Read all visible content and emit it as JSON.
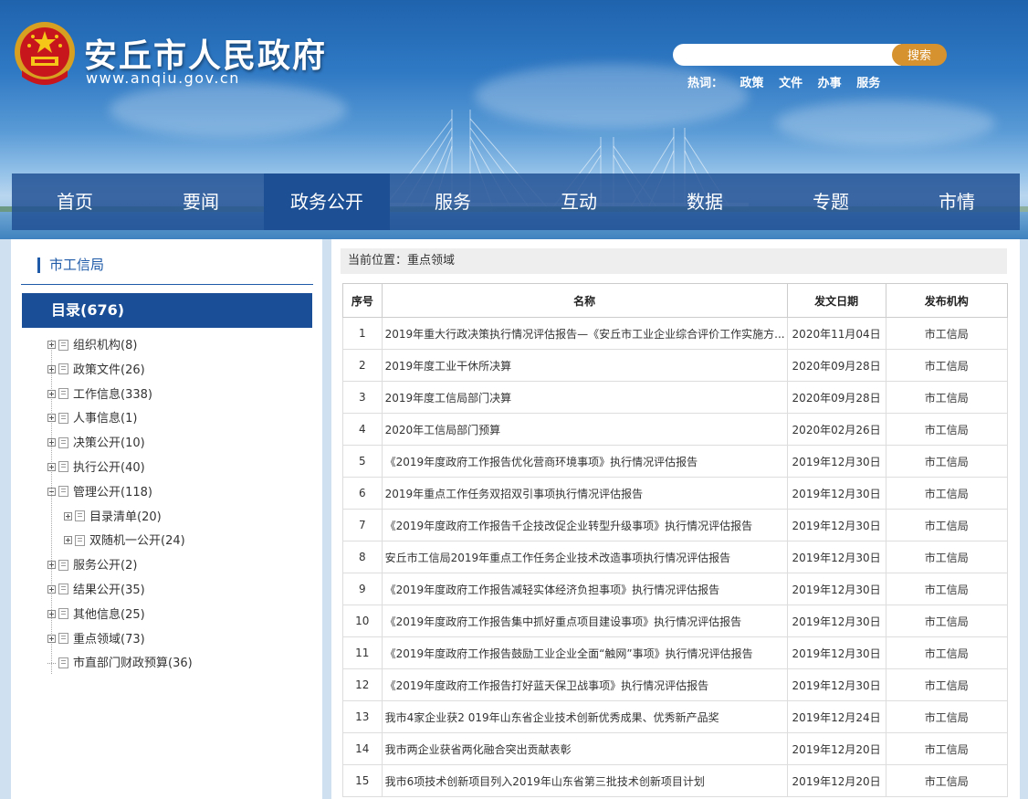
{
  "site": {
    "title": "安丘市人民政府",
    "url": "www.anqiu.gov.cn",
    "search_placeholder": "",
    "search_button": "搜索",
    "hotwords_label": "热词：",
    "hotwords": [
      "政策",
      "文件",
      "办事",
      "服务"
    ]
  },
  "nav": {
    "items": [
      "首页",
      "要闻",
      "政务公开",
      "服务",
      "互动",
      "数据",
      "专题",
      "市情"
    ],
    "active": "政务公开"
  },
  "sidebar": {
    "dept": "市工信局",
    "catalog": "目录(676)",
    "tree": [
      {
        "label": "组织机构(8)",
        "expander": "plus"
      },
      {
        "label": "政策文件(26)",
        "expander": "plus"
      },
      {
        "label": "工作信息(338)",
        "expander": "plus"
      },
      {
        "label": "人事信息(1)",
        "expander": "plus"
      },
      {
        "label": "决策公开(10)",
        "expander": "plus"
      },
      {
        "label": "执行公开(40)",
        "expander": "plus"
      },
      {
        "label": "管理公开(118)",
        "expander": "minus"
      },
      {
        "label": "目录清单(20)",
        "expander": "plus",
        "child": true
      },
      {
        "label": "双随机一公开(24)",
        "expander": "plus",
        "child": true
      },
      {
        "label": "服务公开(2)",
        "expander": "plus"
      },
      {
        "label": "结果公开(35)",
        "expander": "plus"
      },
      {
        "label": "其他信息(25)",
        "expander": "plus"
      },
      {
        "label": "重点领域(73)",
        "expander": "plus"
      },
      {
        "label": "市直部门财政预算(36)",
        "expander": "none"
      }
    ]
  },
  "main": {
    "breadcrumb": "当前位置：重点领域",
    "columns": [
      "序号",
      "名称",
      "发文日期",
      "发布机构"
    ],
    "rows": [
      {
        "idx": "1",
        "name": "2019年重大行政决策执行情况评估报告—《安丘市工业企业综合评价工作实施方...",
        "date": "2020年11月04日",
        "org": "市工信局"
      },
      {
        "idx": "2",
        "name": "2019年度工业干休所决算",
        "date": "2020年09月28日",
        "org": "市工信局"
      },
      {
        "idx": "3",
        "name": "2019年度工信局部门决算",
        "date": "2020年09月28日",
        "org": "市工信局"
      },
      {
        "idx": "4",
        "name": "2020年工信局部门预算",
        "date": "2020年02月26日",
        "org": "市工信局"
      },
      {
        "idx": "5",
        "name": "《2019年度政府工作报告优化营商环境事项》执行情况评估报告",
        "date": "2019年12月30日",
        "org": "市工信局"
      },
      {
        "idx": "6",
        "name": "2019年重点工作任务双招双引事项执行情况评估报告",
        "date": "2019年12月30日",
        "org": "市工信局"
      },
      {
        "idx": "7",
        "name": "《2019年度政府工作报告千企技改促企业转型升级事项》执行情况评估报告",
        "date": "2019年12月30日",
        "org": "市工信局"
      },
      {
        "idx": "8",
        "name": "安丘市工信局2019年重点工作任务企业技术改造事项执行情况评估报告",
        "date": "2019年12月30日",
        "org": "市工信局"
      },
      {
        "idx": "9",
        "name": "《2019年度政府工作报告减轻实体经济负担事项》执行情况评估报告",
        "date": "2019年12月30日",
        "org": "市工信局"
      },
      {
        "idx": "10",
        "name": "《2019年度政府工作报告集中抓好重点项目建设事项》执行情况评估报告",
        "date": "2019年12月30日",
        "org": "市工信局"
      },
      {
        "idx": "11",
        "name": "《2019年度政府工作报告鼓励工业企业全面“触网”事项》执行情况评估报告",
        "date": "2019年12月30日",
        "org": "市工信局"
      },
      {
        "idx": "12",
        "name": "《2019年度政府工作报告打好蓝天保卫战事项》执行情况评估报告",
        "date": "2019年12月30日",
        "org": "市工信局"
      },
      {
        "idx": "13",
        "name": "我市4家企业获2 019年山东省企业技术创新优秀成果、优秀新产品奖",
        "date": "2019年12月24日",
        "org": "市工信局"
      },
      {
        "idx": "14",
        "name": "我市两企业获省两化融合突出贡献表彰",
        "date": "2019年12月20日",
        "org": "市工信局"
      },
      {
        "idx": "15",
        "name": "我市6项技术创新项目列入2019年山东省第三批技术创新项目计划",
        "date": "2019年12月20日",
        "org": "市工信局"
      }
    ]
  }
}
